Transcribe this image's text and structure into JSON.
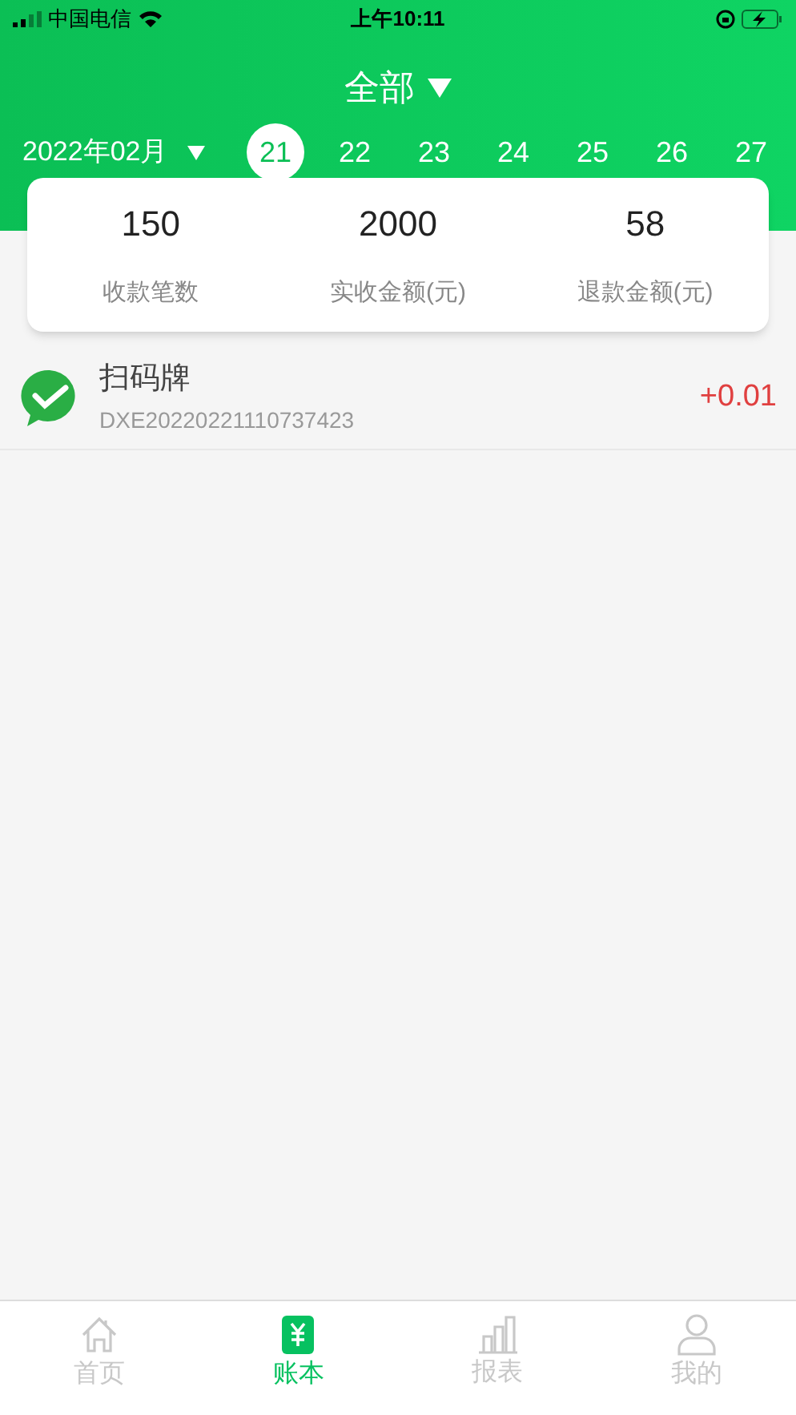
{
  "status_bar": {
    "carrier": "中国电信",
    "time": "上午10:11"
  },
  "header": {
    "filter": "全部",
    "month": "2022年02月",
    "days": [
      {
        "label": "21",
        "selected": true
      },
      {
        "label": "22",
        "selected": false
      },
      {
        "label": "23",
        "selected": false
      },
      {
        "label": "24",
        "selected": false
      },
      {
        "label": "25",
        "selected": false
      },
      {
        "label": "26",
        "selected": false
      },
      {
        "label": "27",
        "selected": false
      }
    ]
  },
  "summary": [
    {
      "value": "150",
      "label": "收款笔数"
    },
    {
      "value": "2000",
      "label": "实收金额(元)"
    },
    {
      "value": "58",
      "label": "退款金额(元)"
    }
  ],
  "transactions": [
    {
      "title": "扫码牌",
      "order_no": "DXE20220221110737423",
      "amount": "+0.01"
    }
  ],
  "tab_bar": [
    {
      "kind": "home",
      "label": "首页",
      "selected": false
    },
    {
      "kind": "ledger",
      "label": "账本",
      "selected": true
    },
    {
      "kind": "report",
      "label": "报表",
      "selected": false
    },
    {
      "kind": "profile",
      "label": "我的",
      "selected": false
    }
  ]
}
